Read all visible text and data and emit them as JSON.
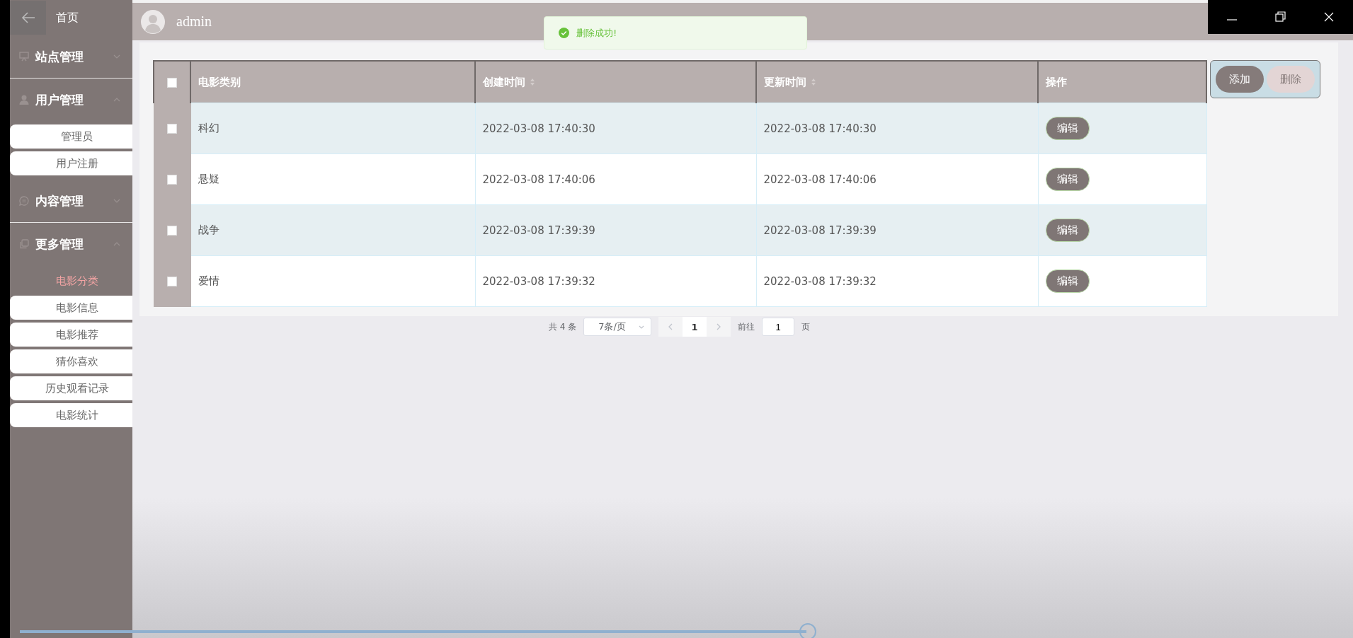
{
  "sidebar": {
    "home": "首页",
    "groups": [
      {
        "label": "站点管理",
        "expanded": false
      },
      {
        "label": "用户管理",
        "expanded": true,
        "children": [
          {
            "label": "管理员",
            "selected": false
          },
          {
            "label": "用户注册",
            "selected": false
          }
        ]
      },
      {
        "label": "内容管理",
        "expanded": false
      },
      {
        "label": "更多管理",
        "expanded": true,
        "children": [
          {
            "label": "电影分类",
            "selected": true
          },
          {
            "label": "电影信息",
            "selected": false
          },
          {
            "label": "电影推荐",
            "selected": false
          },
          {
            "label": "猜你喜欢",
            "selected": false
          },
          {
            "label": "历史观看记录",
            "selected": false
          },
          {
            "label": "电影统计",
            "selected": false
          }
        ]
      }
    ]
  },
  "topbar": {
    "username": "admin"
  },
  "toast": {
    "kind": "success",
    "message": "删除成功!"
  },
  "table": {
    "header_checked": false,
    "columns": [
      {
        "label": "电影类别",
        "sortable": false
      },
      {
        "label": "创建时间",
        "sortable": true
      },
      {
        "label": "更新时间",
        "sortable": true
      },
      {
        "label": "操作",
        "sortable": false
      }
    ],
    "rows": [
      {
        "checked": false,
        "category": "科幻",
        "created": "2022-03-08 17:40:30",
        "updated": "2022-03-08 17:40:30",
        "action": "编辑"
      },
      {
        "checked": false,
        "category": "悬疑",
        "created": "2022-03-08 17:40:06",
        "updated": "2022-03-08 17:40:06",
        "action": "编辑"
      },
      {
        "checked": false,
        "category": "战争",
        "created": "2022-03-08 17:39:39",
        "updated": "2022-03-08 17:39:39",
        "action": "编辑"
      },
      {
        "checked": false,
        "category": "爱情",
        "created": "2022-03-08 17:39:32",
        "updated": "2022-03-08 17:39:32",
        "action": "编辑"
      }
    ]
  },
  "actions": [
    {
      "label": "添加",
      "disabled": false
    },
    {
      "label": "删除",
      "disabled": true
    }
  ],
  "pagination": {
    "total": "共 4 条",
    "page_size": "7条/页",
    "pages": [
      {
        "label": "1",
        "selected": true
      }
    ],
    "goto_label": "前往",
    "goto_value": "1",
    "page_unit": "页"
  },
  "video": {
    "level": 0.59
  }
}
